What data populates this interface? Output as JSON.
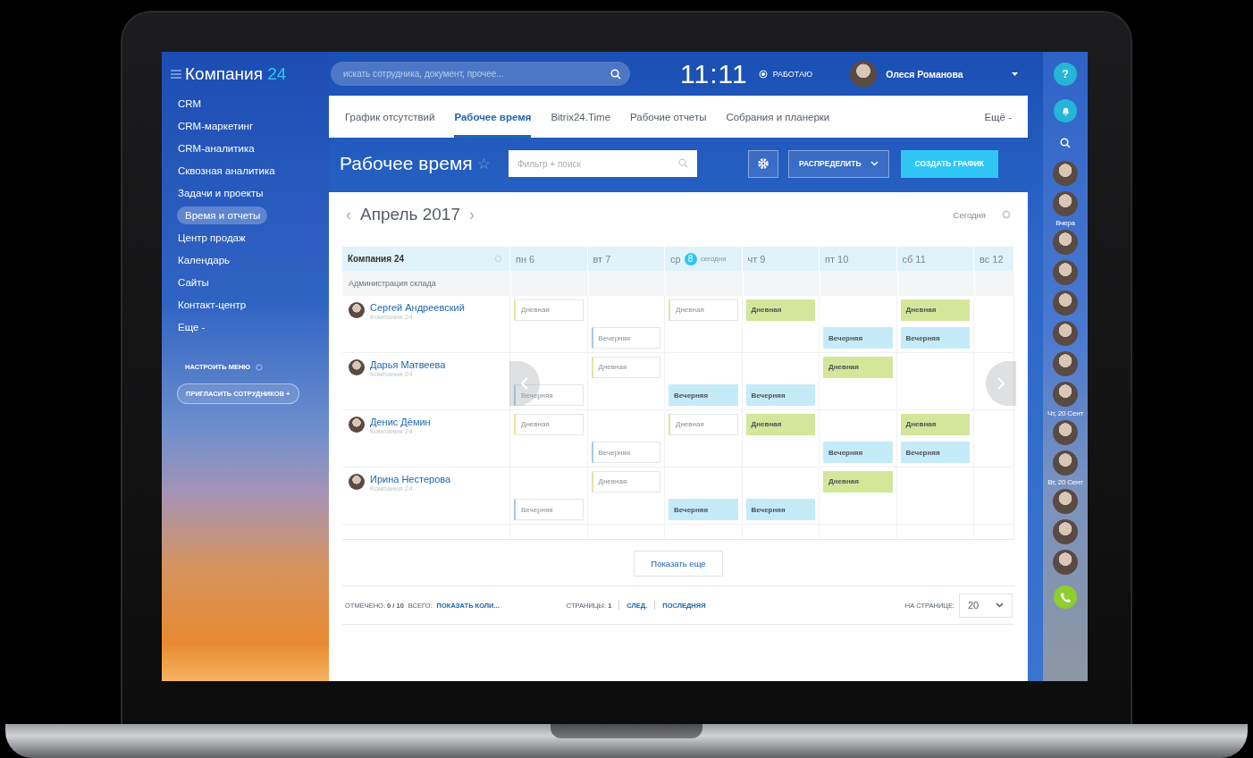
{
  "header": {
    "logo": "Компания",
    "logo_number": "24",
    "search": {
      "placeholder": "искать сотрудника, документ, прочее..."
    },
    "clock": "11:11",
    "status": "РАБОТАЮ",
    "user": "Олеся Романова"
  },
  "sidebar": {
    "items": [
      {
        "label": "CRM",
        "selected": false
      },
      {
        "label": "CRM-маркетинг",
        "selected": false
      },
      {
        "label": "CRM-аналитика",
        "selected": false
      },
      {
        "label": "Сквозная аналитика",
        "selected": false
      },
      {
        "label": "Задачи и проекты",
        "selected": false
      },
      {
        "label": "Время и отчеты",
        "selected": true
      },
      {
        "label": "Центр продаж",
        "selected": false
      },
      {
        "label": "Календарь",
        "selected": false
      },
      {
        "label": "Сайты",
        "selected": false
      },
      {
        "label": "Контакт-центр",
        "selected": false
      },
      {
        "label": "Еще -",
        "selected": false
      }
    ],
    "settings": "НАСТРОИТЬ МЕНЮ",
    "invite": "ПРИГЛАСИТЬ СОТРУДНИКОВ",
    "invite_icon": "+"
  },
  "tabs": [
    {
      "label": "График отсутствий",
      "selected": false
    },
    {
      "label": "Рабочее время",
      "selected": true
    },
    {
      "label": "Bitrix24.Time",
      "selected": false
    },
    {
      "label": "Рабочие отчеты",
      "selected": false
    },
    {
      "label": "Собрания и планерки",
      "selected": false
    }
  ],
  "tabs_more": "Ещё -",
  "toolbar": {
    "title": "Рабочее время",
    "star": "☆",
    "filter": {
      "placeholder": "Фильтр + поиск"
    },
    "distribute": "РАСПРЕДЕЛИТЬ",
    "create": "СОЗДАТЬ ГРАФИК"
  },
  "calendar": {
    "month": "Апрель 2017",
    "prev": "‹",
    "next": "›",
    "today": "Сегодня",
    "company": "Компания 24",
    "group": "Администрация склада",
    "days": [
      {
        "label": "пн 6",
        "today": false
      },
      {
        "label": "вт 7",
        "today": false
      },
      {
        "label": "ср",
        "date": "8",
        "note": "сегодня",
        "today": true
      },
      {
        "label": "чт 9",
        "today": false
      },
      {
        "label": "пт 10",
        "today": false
      },
      {
        "label": "сб 11",
        "today": false
      },
      {
        "label": "вс 12",
        "today": false
      }
    ],
    "employees": [
      {
        "name": "Сергей Андреевский",
        "company": "Компания 24",
        "rows": [
          {
            "cells": [
              {
                "kind": "day",
                "label": "Дневная",
                "filled": false
              },
              null,
              {
                "kind": "day",
                "label": "Дневная",
                "filled": false
              },
              {
                "kind": "day",
                "label": "Дневная",
                "filled": true
              },
              null,
              {
                "kind": "day",
                "label": "Дневная",
                "filled": true
              },
              null
            ]
          },
          {
            "cells": [
              null,
              {
                "kind": "evening",
                "label": "Вечерняя",
                "filled": false
              },
              null,
              null,
              {
                "kind": "evening",
                "label": "Вечерняя",
                "filled": true
              },
              {
                "kind": "evening",
                "label": "Вечерняя",
                "filled": true
              },
              null
            ]
          }
        ]
      },
      {
        "name": "Дарья Матвеева",
        "company": "Компания 24",
        "rows": [
          {
            "cells": [
              null,
              {
                "kind": "day",
                "label": "Дневная",
                "filled": false
              },
              null,
              null,
              {
                "kind": "day",
                "label": "Дневная",
                "filled": true
              },
              null,
              null
            ]
          },
          {
            "cells": [
              {
                "kind": "evening",
                "label": "Вечерняя",
                "filled": false
              },
              null,
              {
                "kind": "evening",
                "label": "Вечерняя",
                "filled": true
              },
              {
                "kind": "evening",
                "label": "Вечерняя",
                "filled": true
              },
              null,
              null,
              null
            ]
          }
        ]
      },
      {
        "name": "Денис Дёмин",
        "company": "Компания 24",
        "rows": [
          {
            "cells": [
              {
                "kind": "day",
                "label": "Дневная",
                "filled": false
              },
              null,
              {
                "kind": "day",
                "label": "Дневная",
                "filled": false
              },
              {
                "kind": "day",
                "label": "Дневная",
                "filled": true
              },
              null,
              {
                "kind": "day",
                "label": "Дневная",
                "filled": true
              },
              null
            ]
          },
          {
            "cells": [
              null,
              {
                "kind": "evening",
                "label": "Вечерняя",
                "filled": false
              },
              null,
              null,
              {
                "kind": "evening",
                "label": "Вечерняя",
                "filled": true
              },
              {
                "kind": "evening",
                "label": "Вечерняя",
                "filled": true
              },
              null
            ]
          }
        ]
      },
      {
        "name": "Ирина Нестерова",
        "company": "Компания 24",
        "rows": [
          {
            "cells": [
              null,
              {
                "kind": "day",
                "label": "Дневная",
                "filled": false
              },
              null,
              null,
              {
                "kind": "day",
                "label": "Дневная",
                "filled": true
              },
              null,
              null
            ]
          },
          {
            "cells": [
              {
                "kind": "evening",
                "label": "Вечерняя",
                "filled": false
              },
              null,
              {
                "kind": "evening",
                "label": "Вечерняя",
                "filled": true
              },
              {
                "kind": "evening",
                "label": "Вечерняя",
                "filled": true
              },
              null,
              null,
              null
            ]
          }
        ]
      }
    ]
  },
  "show_more": "Показать еще",
  "footer": {
    "checked_label": "ОТМЕЧЕНО:",
    "checked": "0 / 10",
    "total_label": "ВСЕГО:",
    "total_link": "ПОКАЗАТЬ КОЛИ...",
    "pages_label": "СТРАНИЦЫ:",
    "page": "1",
    "next": "СЛЕД.",
    "last": "ПОСЛЕДНЯЯ",
    "per_page_label": "НА СТРАНИЦЕ:",
    "per_page": "20"
  },
  "right_bar": {
    "items": [
      {
        "kind": "help",
        "label": "?"
      },
      {
        "kind": "bell"
      },
      {
        "kind": "search"
      },
      {
        "kind": "avatar"
      },
      {
        "kind": "avatar"
      },
      {
        "kind": "date",
        "label": "Вчера"
      },
      {
        "kind": "avatar"
      },
      {
        "kind": "avatar"
      },
      {
        "kind": "avatar"
      },
      {
        "kind": "avatar"
      },
      {
        "kind": "avatar"
      },
      {
        "kind": "avatar"
      },
      {
        "kind": "date",
        "label": "Чт, 20 Сент"
      },
      {
        "kind": "avatar"
      },
      {
        "kind": "avatar"
      },
      {
        "kind": "date",
        "label": "Вт, 20 Сент"
      },
      {
        "kind": "avatar"
      },
      {
        "kind": "avatar"
      },
      {
        "kind": "avatar"
      },
      {
        "kind": "phone"
      }
    ]
  }
}
